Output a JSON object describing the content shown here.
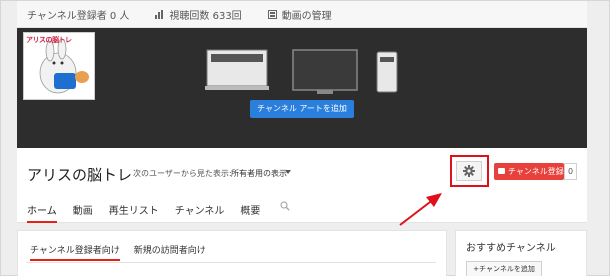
{
  "stats": {
    "subscribers": "チャンネル登録者 0 人",
    "views": "視聴回数 633回",
    "manage": "動画の管理"
  },
  "banner": {
    "avatar_text": "アリスの脳トレ",
    "add_art_label": "チャンネル アートを追加"
  },
  "channel": {
    "name": "アリスの脳トレ",
    "view_as_label": "次のユーザーから見た表示:",
    "view_as_value": "所有者用の表示",
    "subscribe_label": "チャンネル登録",
    "subscriber_count": "0"
  },
  "tabs": [
    {
      "label": "ホーム",
      "active": true
    },
    {
      "label": "動画"
    },
    {
      "label": "再生リスト"
    },
    {
      "label": "チャンネル"
    },
    {
      "label": "概要"
    }
  ],
  "subtabs": [
    {
      "label": "チャンネル登録者向け",
      "active": true
    },
    {
      "label": "新規の訪問者向け"
    }
  ],
  "sidebar": {
    "title": "おすすめチャンネル",
    "add_button": "+チャンネルを追加"
  },
  "colors": {
    "accent": "#e62117",
    "banner_bg": "#2d2d2d",
    "art_button": "#2b7fdc",
    "subscribe_bg": "#e8403a",
    "highlight": "#e0101a"
  }
}
